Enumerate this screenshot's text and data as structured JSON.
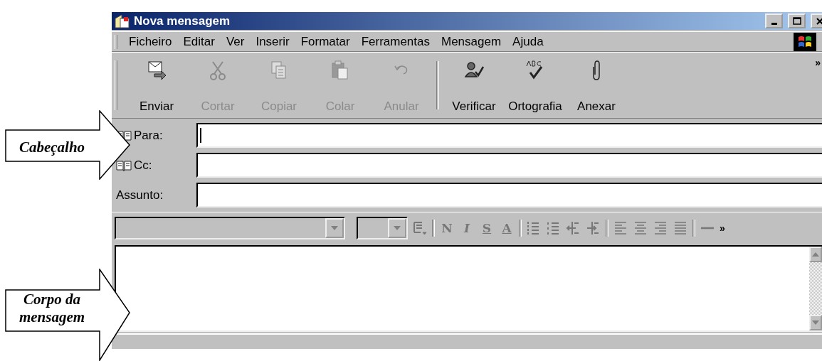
{
  "window": {
    "title": "Nova mensagem"
  },
  "menu": [
    {
      "label": "Ficheiro"
    },
    {
      "label": "Editar"
    },
    {
      "label": "Ver"
    },
    {
      "label": "Inserir"
    },
    {
      "label": "Formatar"
    },
    {
      "label": "Ferramentas"
    },
    {
      "label": "Mensagem"
    },
    {
      "label": "Ajuda"
    }
  ],
  "toolbar_groups": [
    {
      "buttons": [
        {
          "kind": "send",
          "label": "Enviar",
          "disabled": false
        },
        {
          "kind": "cut",
          "label": "Cortar",
          "disabled": true
        },
        {
          "kind": "copy",
          "label": "Copiar",
          "disabled": true
        },
        {
          "kind": "paste",
          "label": "Colar",
          "disabled": true
        },
        {
          "kind": "undo",
          "label": "Anular",
          "disabled": true
        }
      ]
    },
    {
      "buttons": [
        {
          "kind": "check",
          "label": "Verificar",
          "disabled": false
        },
        {
          "kind": "spelling",
          "label": "Ortografia",
          "disabled": false
        },
        {
          "kind": "attach",
          "label": "Anexar",
          "disabled": false
        }
      ]
    }
  ],
  "toolbar_more": "»",
  "header_fields": [
    {
      "kind": "address",
      "label": "Para:",
      "focused": true
    },
    {
      "kind": "address",
      "label": "Cc:",
      "focused": false
    },
    {
      "kind": "plain",
      "label": "Assunto:",
      "focused": false
    }
  ],
  "format_bar": {
    "font_dropdown": {
      "disabled": true
    },
    "size_dropdown": {
      "disabled": true
    },
    "buttons": [
      {
        "kind": "style"
      },
      {
        "kind": "sep"
      },
      {
        "kind": "bold",
        "label": "N"
      },
      {
        "kind": "italic",
        "label": "I"
      },
      {
        "kind": "underline",
        "label": "S"
      },
      {
        "kind": "color",
        "label": "A"
      },
      {
        "kind": "sep"
      },
      {
        "kind": "numbered-list"
      },
      {
        "kind": "bullet-list"
      },
      {
        "kind": "outdent"
      },
      {
        "kind": "indent"
      },
      {
        "kind": "sep"
      },
      {
        "kind": "align-left"
      },
      {
        "kind": "align-center"
      },
      {
        "kind": "align-right"
      },
      {
        "kind": "justify"
      },
      {
        "kind": "sep"
      },
      {
        "kind": "horizontal-line"
      }
    ],
    "more": "»"
  },
  "callouts": [
    {
      "kind": "header",
      "label": "Cabeçalho"
    },
    {
      "kind": "body",
      "label": "Corpo da mensagem"
    }
  ]
}
